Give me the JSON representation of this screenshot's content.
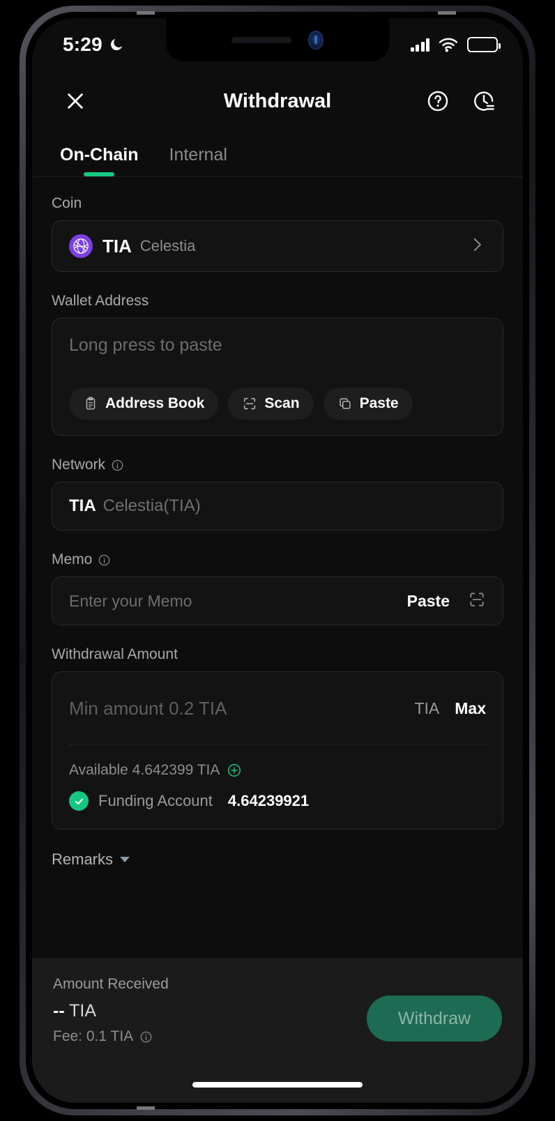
{
  "status_bar": {
    "time": "5:29",
    "moon_icon": "moon-icon",
    "signal_icon": "cellular-signal-icon",
    "wifi_icon": "wifi-icon",
    "battery_icon": "battery-icon"
  },
  "header": {
    "close_icon": "close-icon",
    "title": "Withdrawal",
    "help_icon": "help-circle-icon",
    "history_icon": "history-clock-icon"
  },
  "tabs": [
    {
      "label": "On-Chain",
      "active": true
    },
    {
      "label": "Internal",
      "active": false
    }
  ],
  "coin": {
    "label": "Coin",
    "symbol": "TIA",
    "name": "Celestia",
    "logo_icon": "celestia-coin-icon",
    "chevron_icon": "chevron-right-icon"
  },
  "wallet_address": {
    "label": "Wallet Address",
    "placeholder": "Long press to paste",
    "value": "",
    "actions": [
      {
        "label": "Address Book",
        "icon": "clipboard-icon"
      },
      {
        "label": "Scan",
        "icon": "scan-icon"
      },
      {
        "label": "Paste",
        "icon": "copy-icon"
      }
    ]
  },
  "network": {
    "label": "Network",
    "info_icon": "info-icon",
    "symbol": "TIA",
    "name": "Celestia(TIA)"
  },
  "memo": {
    "label": "Memo",
    "info_icon": "info-icon",
    "placeholder": "Enter your Memo",
    "value": "",
    "paste_label": "Paste",
    "scan_icon": "scan-icon"
  },
  "amount": {
    "label": "Withdrawal Amount",
    "placeholder": "Min amount 0.2 TIA",
    "value": "",
    "unit": "TIA",
    "max_label": "Max",
    "available_text": "Available 4.642399 TIA",
    "add_icon": "plus-circle-icon",
    "account_check_icon": "check-circle-icon",
    "account_label": "Funding Account",
    "account_balance": "4.64239921"
  },
  "remarks": {
    "label": "Remarks",
    "caret_icon": "chevron-down-icon"
  },
  "footer": {
    "received_label": "Amount Received",
    "received_value": "--",
    "received_unit": "TIA",
    "fee_text": "Fee: 0.1 TIA",
    "fee_info_icon": "info-icon",
    "submit_label": "Withdraw"
  },
  "colors": {
    "accent_green": "#16c784",
    "button_green": "#1c6b52",
    "coin_purple": "#7b3fe4",
    "background": "#0d0d0d",
    "footer_background": "#1b1b1b"
  }
}
